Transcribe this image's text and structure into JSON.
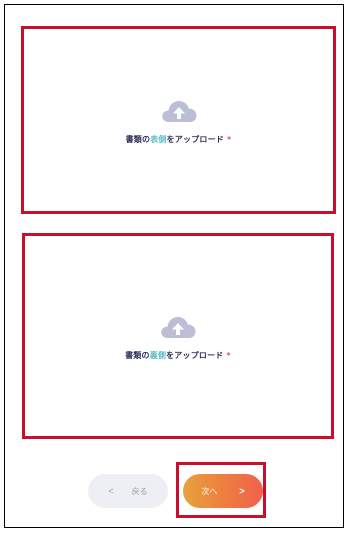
{
  "uploads": {
    "front": {
      "label_before": "書類の",
      "label_accent": "表側",
      "label_after": "をアップロード",
      "required_mark": "*"
    },
    "back": {
      "label_before": "書類の",
      "label_accent": "裏側",
      "label_after": "をアップロード",
      "required_mark": "*"
    }
  },
  "icons": {
    "upload": "cloud-upload-icon",
    "back": "chevron-left-icon",
    "next": "chevron-right-icon"
  },
  "nav": {
    "back_chevron": "<",
    "back_label": "戻る",
    "next_label": "次へ",
    "next_chevron": ">"
  },
  "colors": {
    "highlight": "#c8102e",
    "label_text": "#2e2f5b",
    "label_accent": "#5bbdc4",
    "required": "#e0524d",
    "next_gradient_start": "#e8a23c",
    "next_gradient_end": "#f0604b",
    "back_bg": "#eeeff4"
  }
}
